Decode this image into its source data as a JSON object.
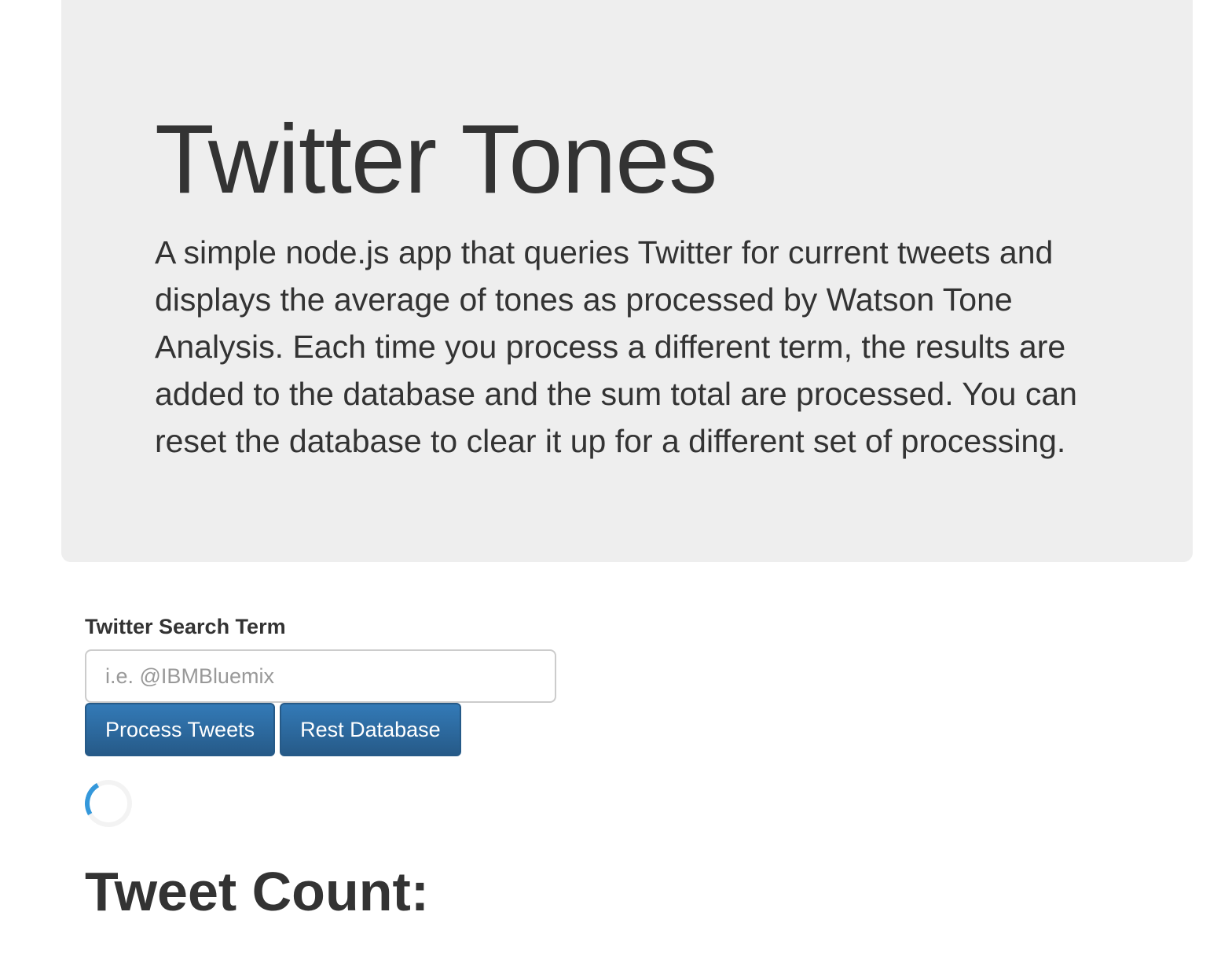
{
  "hero": {
    "title": "Twitter Tones",
    "description": "A simple node.js app that queries Twitter for current tweets and displays the average of tones as processed by Watson Tone Analysis. Each time you process a different term, the results are added to the database and the sum total are processed. You can reset the database to clear it up for a different set of processing."
  },
  "form": {
    "label": "Twitter Search Term",
    "search_value": "",
    "search_placeholder": "i.e. @IBMBluemix",
    "process_button_label": "Process Tweets",
    "reset_button_label": "Rest Database"
  },
  "loading": {
    "icon": "spinner-icon",
    "color": "#3498db"
  },
  "results": {
    "count_heading": "Tweet Count:"
  },
  "colors": {
    "jumbotron_bg": "#eeeeee",
    "button_primary": "#337ab7",
    "text": "#333333"
  }
}
